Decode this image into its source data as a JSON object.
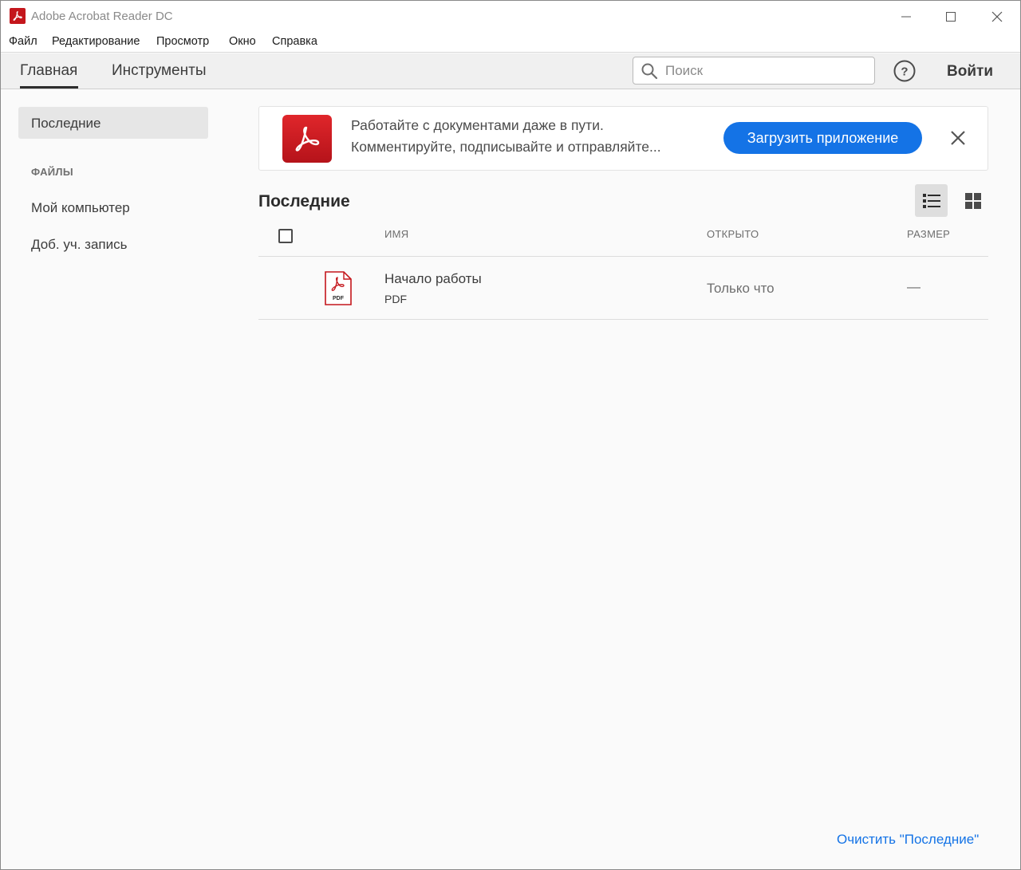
{
  "window": {
    "title": "Adobe Acrobat Reader DC",
    "accent_color": "#c4161c"
  },
  "menu": {
    "items": [
      "Файл",
      "Редактирование",
      "Просмотр",
      "Окно",
      "Справка"
    ]
  },
  "tabs": {
    "home": "Главная",
    "tools": "Инструменты"
  },
  "search": {
    "placeholder": "Поиск"
  },
  "header": {
    "help_icon": "question-circle-icon",
    "signin_label": "Войти"
  },
  "sidebar": {
    "active_item": "Последние",
    "files_header": "ФАЙЛЫ",
    "items": [
      "Мой компьютер",
      "Доб. уч. запись"
    ]
  },
  "banner": {
    "line1": "Работайте с документами даже в пути.",
    "line2": "Комментируйте, подписывайте и отправляйте...",
    "button_label": "Загрузить приложение",
    "button_color": "#1473e6"
  },
  "recents": {
    "title": "Последние",
    "columns": {
      "name": "ИМЯ",
      "opened": "ОТКРЫТО",
      "size": "РАЗМЕР"
    },
    "files": [
      {
        "name": "Начало работы",
        "type": "PDF",
        "opened": "Только что",
        "size": "—"
      }
    ],
    "clear_label": "Очистить \"Последние\""
  }
}
